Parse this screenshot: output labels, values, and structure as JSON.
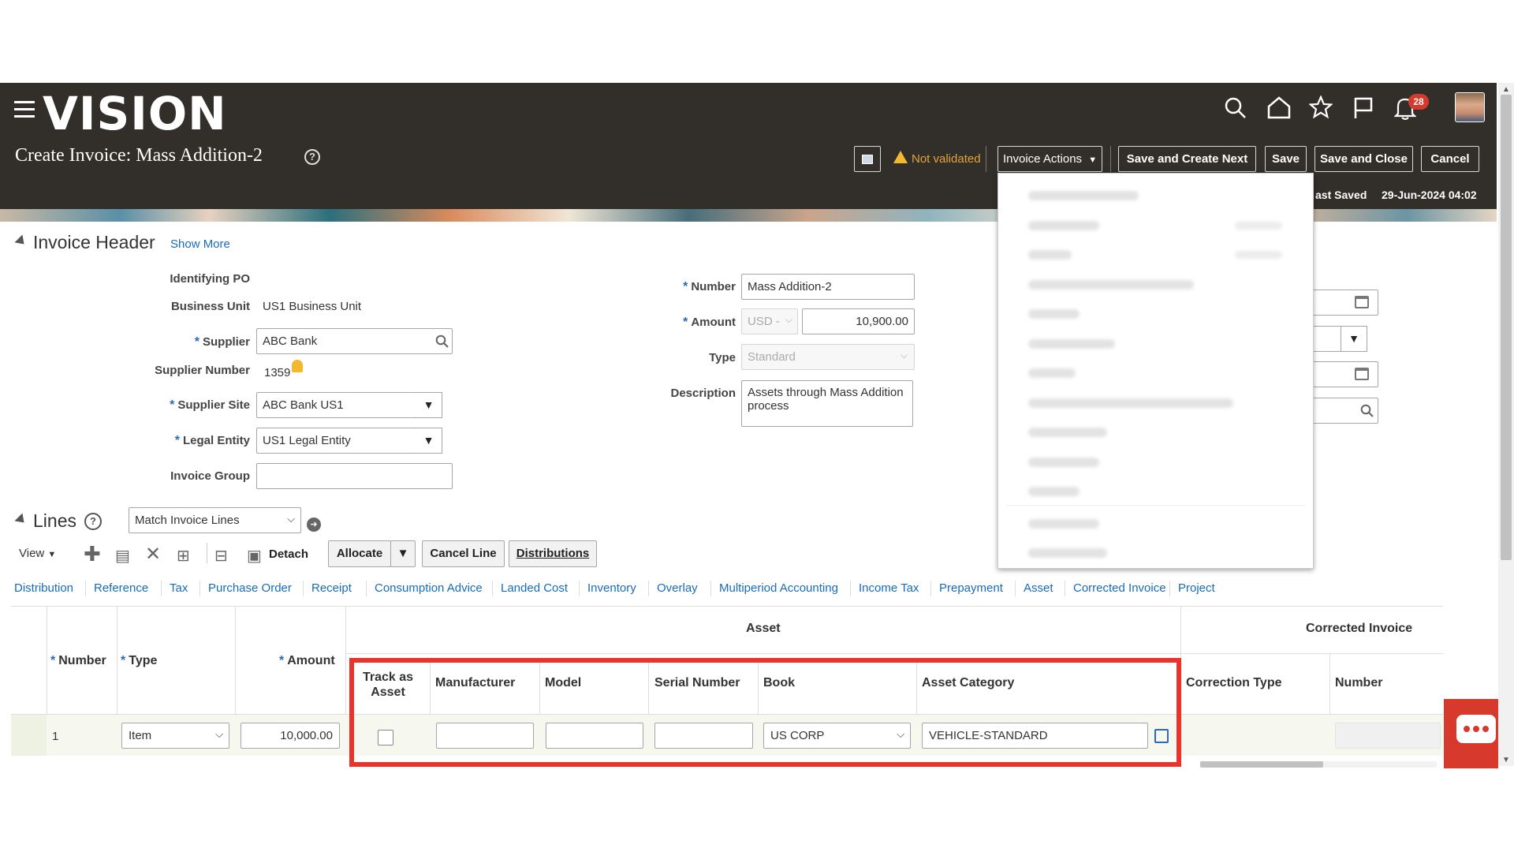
{
  "header": {
    "logo": "VISION",
    "page_title": "Create Invoice: Mass Addition-2",
    "notification_count": "28",
    "status": "Not validated",
    "invoice_actions_label": "Invoice Actions",
    "save_create_next_label": "Save and Create Next",
    "save_label": "Save",
    "save_close_label": "Save and Close",
    "cancel_label": "Cancel",
    "last_saved_label": "ast Saved",
    "last_saved_value": "29-Jun-2024 04:02",
    "icons": [
      "menu-icon",
      "search-icon",
      "home-icon",
      "star-icon",
      "flag-icon",
      "bell-icon",
      "avatar"
    ]
  },
  "invoice_header": {
    "title": "Invoice Header",
    "show_more": "Show More",
    "identifying_po_label": "Identifying PO",
    "business_unit_label": "Business Unit",
    "business_unit_value": "US1 Business Unit",
    "supplier_label": "Supplier",
    "supplier_value": "ABC Bank",
    "supplier_number_label": "Supplier Number",
    "supplier_number_value": "1359",
    "supplier_site_label": "Supplier Site",
    "supplier_site_value": "ABC Bank US1",
    "legal_entity_label": "Legal Entity",
    "legal_entity_value": "US1 Legal Entity",
    "invoice_group_label": "Invoice Group",
    "invoice_group_value": "",
    "number_label": "Number",
    "number_value": "Mass Addition-2",
    "amount_label": "Amount",
    "currency_value": "USD -",
    "amount_value": "10,900.00",
    "type_label": "Type",
    "type_value": "Standard",
    "description_label": "Description",
    "description_value": "Assets through Mass Addition process"
  },
  "lines": {
    "title": "Lines",
    "match_select": "Match Invoice Lines",
    "view_label": "View",
    "detach_label": "Detach",
    "allocate_label": "Allocate",
    "cancel_line_label": "Cancel Line",
    "distributions_label": "Distributions",
    "tabs": [
      "Distribution",
      "Reference",
      "Tax",
      "Purchase Order",
      "Receipt",
      "Consumption Advice",
      "Landed Cost",
      "Inventory",
      "Overlay",
      "Multiperiod Accounting",
      "Income Tax",
      "Prepayment",
      "Asset",
      "Corrected Invoice",
      "Project"
    ],
    "columns": {
      "number": "Number",
      "type": "Type",
      "amount": "Amount",
      "asset_group": "Asset",
      "track_as_asset": "Track as Asset",
      "manufacturer": "Manufacturer",
      "model": "Model",
      "serial_number": "Serial Number",
      "book": "Book",
      "asset_category": "Asset Category",
      "corrected_invoice_group": "Corrected Invoice",
      "correction_type": "Correction Type",
      "corr_number": "Number"
    },
    "row": {
      "number": "1",
      "type": "Item",
      "amount": "10,000.00",
      "manufacturer": "",
      "model": "",
      "serial_number": "",
      "book": "US CORP",
      "asset_category": "VEHICLE-STANDARD"
    }
  },
  "colors": {
    "header_bg": "#322e2a",
    "link": "#1a6bb6",
    "highlight": "#e8342b",
    "warning": "#e3a53a",
    "badge": "#d7392c"
  }
}
